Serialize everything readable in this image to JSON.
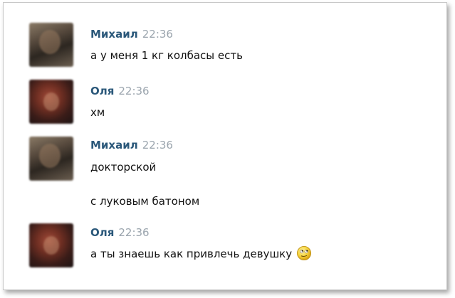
{
  "messages": [
    {
      "author": "Михаил",
      "time": "22:36",
      "lines": [
        "а у меня 1 кг колбасы есть"
      ]
    },
    {
      "author": "Оля",
      "time": "22:36",
      "lines": [
        "хм"
      ]
    },
    {
      "author": "Михаил",
      "time": "22:36",
      "lines": [
        "докторской",
        "с луковым батоном"
      ]
    },
    {
      "author": "Оля",
      "time": "22:36",
      "lines": [
        "а ты знаешь как привлечь девушку"
      ],
      "emoji": "rolling-eyes-smiley-icon"
    }
  ],
  "colors": {
    "author": "#2b587a",
    "time": "#9aa4ad",
    "text": "#111111"
  }
}
